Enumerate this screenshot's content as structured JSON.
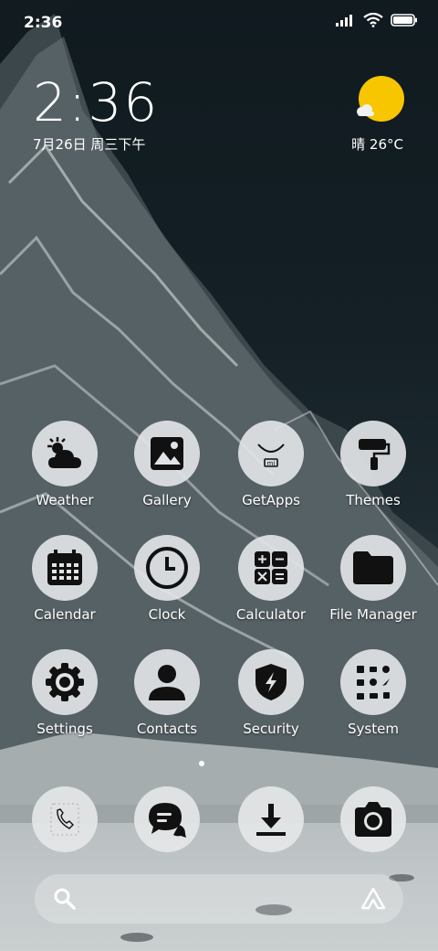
{
  "status_bar": {
    "time": "2:36"
  },
  "clock_widget": {
    "time": "2:36",
    "date": "7月26日 周三下午"
  },
  "weather_widget": {
    "condition": "晴",
    "temperature": "26°C",
    "label": "晴 26°C"
  },
  "apps": [
    {
      "label": "Weather",
      "icon": "weather-icon"
    },
    {
      "label": "Gallery",
      "icon": "gallery-icon"
    },
    {
      "label": "GetApps",
      "icon": "getapps-icon"
    },
    {
      "label": "Themes",
      "icon": "themes-icon"
    },
    {
      "label": "Calendar",
      "icon": "calendar-icon"
    },
    {
      "label": "Clock",
      "icon": "clock-icon"
    },
    {
      "label": "Calculator",
      "icon": "calculator-icon"
    },
    {
      "label": "File Manager",
      "icon": "folder-icon"
    },
    {
      "label": "Settings",
      "icon": "gear-icon"
    },
    {
      "label": "Contacts",
      "icon": "contacts-icon"
    },
    {
      "label": "Security",
      "icon": "shield-icon"
    },
    {
      "label": "System",
      "icon": "system-folder-icon"
    }
  ],
  "dock": [
    {
      "icon": "phone-icon"
    },
    {
      "icon": "messages-icon"
    },
    {
      "icon": "download-icon"
    },
    {
      "icon": "camera-icon"
    }
  ],
  "page_indicator": {
    "pages": 1,
    "current": 1
  },
  "colors": {
    "icon_bg": "#e1e4e6",
    "sun": "#f7c600",
    "glyph": "#111111"
  }
}
